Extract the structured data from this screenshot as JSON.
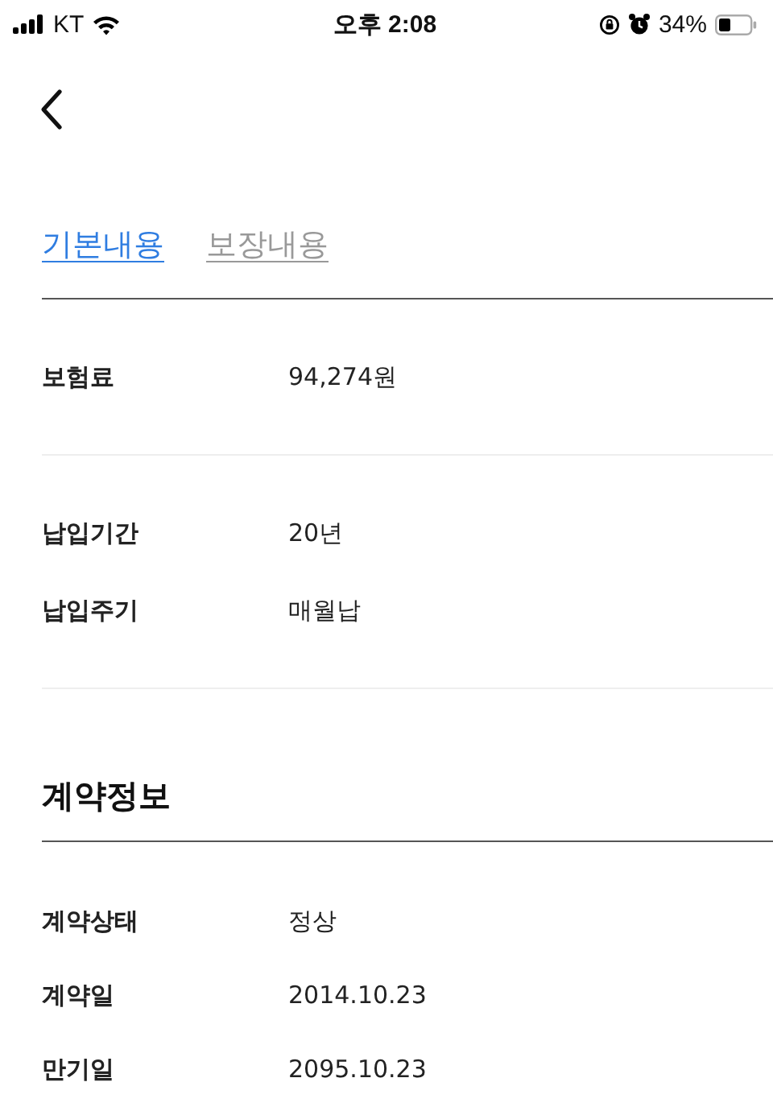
{
  "status_bar": {
    "carrier": "KT",
    "time": "오후 2:08",
    "battery": "34%"
  },
  "tabs": [
    {
      "label": "기본내용",
      "selected": true
    },
    {
      "label": "보장내용",
      "selected": false
    }
  ],
  "groups": [
    {
      "rows": [
        {
          "label": "보험료",
          "value": "94,274원"
        }
      ]
    },
    {
      "rows": [
        {
          "label": "납입기간",
          "value": "20년"
        },
        {
          "label": "납입주기",
          "value": "매월납"
        }
      ]
    }
  ],
  "contract": {
    "title": "계약정보",
    "rows": [
      {
        "label": "계약상태",
        "value": "정상"
      },
      {
        "label": "계약일",
        "value": "2014.10.23"
      },
      {
        "label": "만기일",
        "value": "2095.10.23"
      }
    ]
  }
}
